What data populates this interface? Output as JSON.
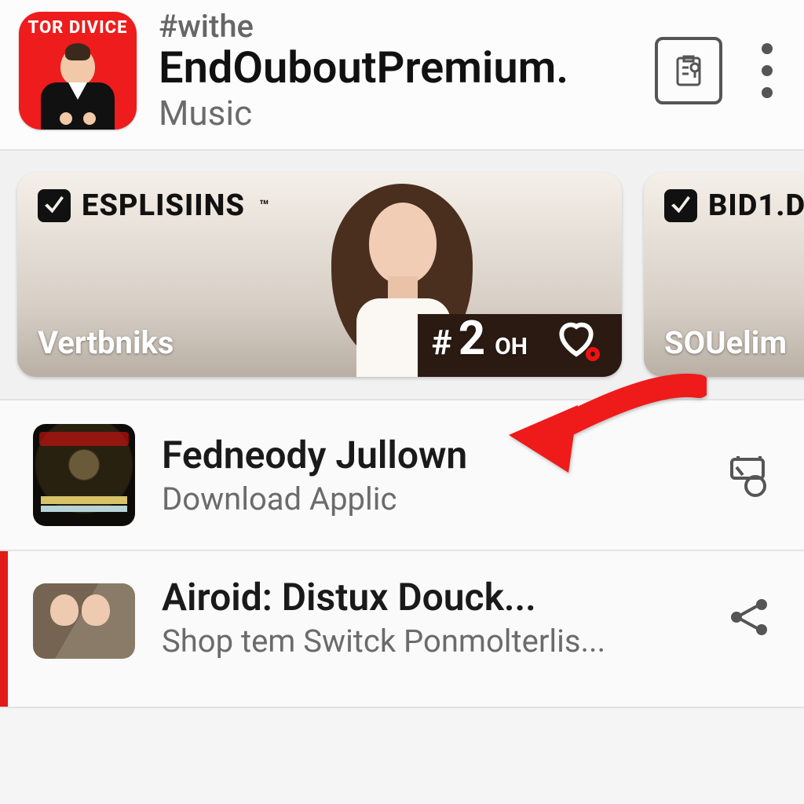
{
  "header": {
    "icon_badge": "TOR DIVICE",
    "tag": "#withe",
    "title": "EndOuboutPremium.",
    "category": "Music"
  },
  "carousel": {
    "cards": [
      {
        "brand": "ESPLISIINS",
        "tm": "™",
        "caption": "Vertbniks",
        "rank_hash": "#",
        "rank_num": "2",
        "rank_suffix": "OH"
      },
      {
        "brand": "BID1.D",
        "caption": "SOUelim"
      }
    ]
  },
  "list": [
    {
      "title": "Fedneody Jullown",
      "subtitle": "Download Applic",
      "action": "queue"
    },
    {
      "title": "Airoid: Distux Douck...",
      "subtitle": "Shop tem Switck Ponmolterlis...",
      "action": "share"
    }
  ]
}
